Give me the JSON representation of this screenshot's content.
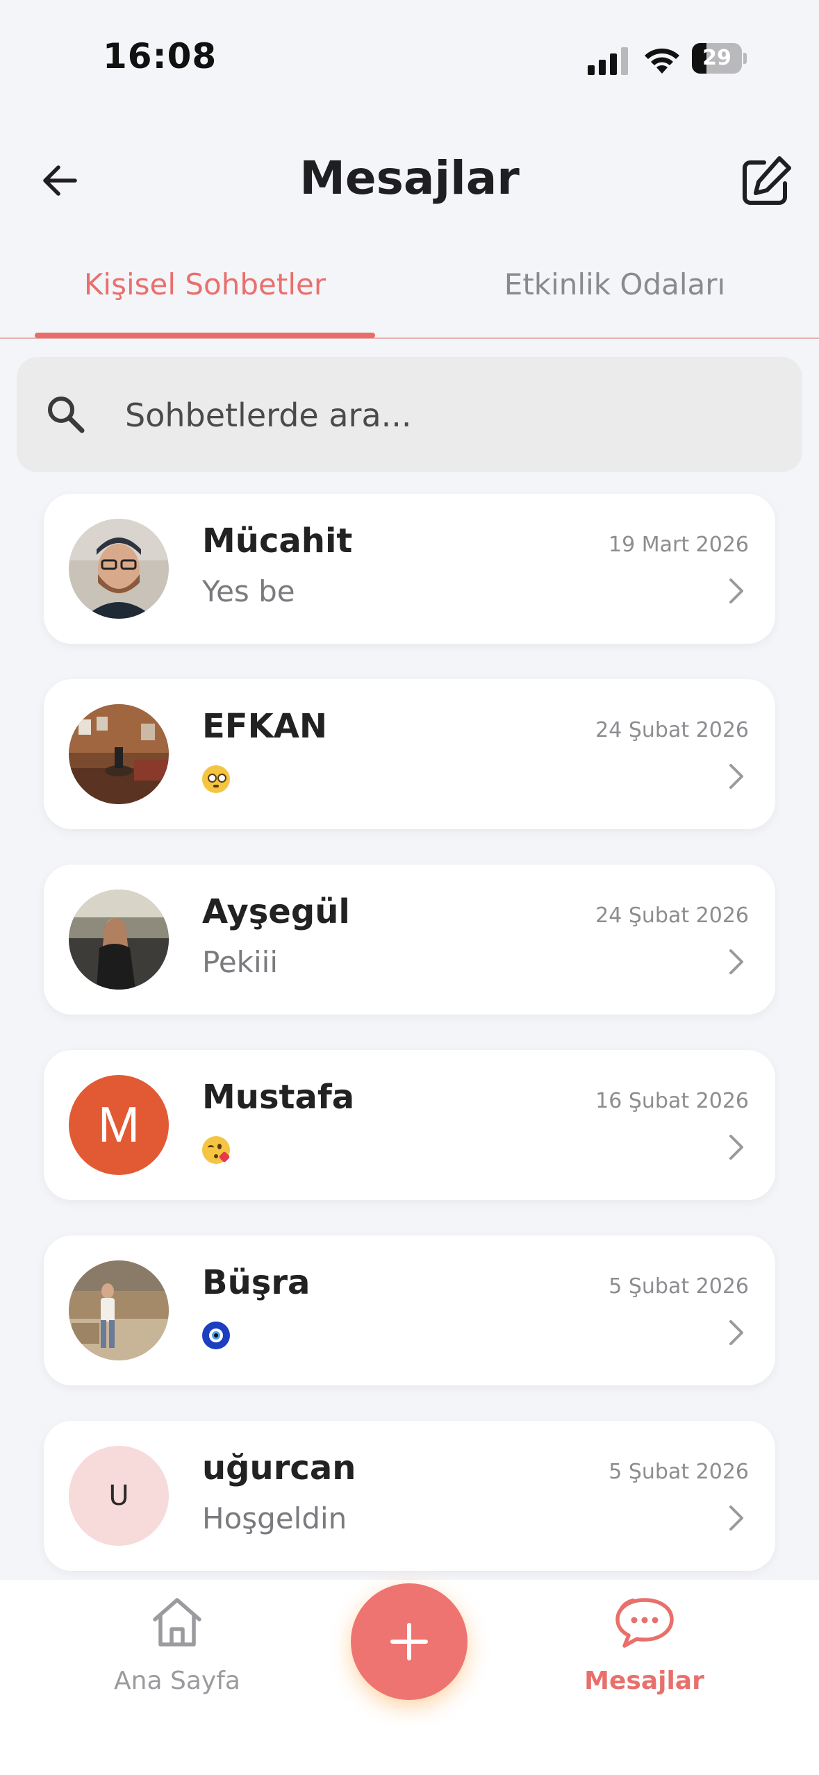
{
  "status_bar": {
    "time": "16:08",
    "battery": "29",
    "battery_level": 0.29
  },
  "header": {
    "title": "Mesajlar",
    "back_icon": "arrow-left-icon",
    "compose_icon": "compose-icon"
  },
  "tabs": [
    {
      "label": "Kişisel Sohbetler",
      "active": true
    },
    {
      "label": "Etkinlik Odaları",
      "active": false
    }
  ],
  "search": {
    "placeholder": "Sohbetlerde ara...",
    "value": ""
  },
  "chats": [
    {
      "name": "Mücahit",
      "preview": "Yes be",
      "date": "19 Mart 2026",
      "avatar": "photo"
    },
    {
      "name": "EFKAN",
      "preview": "😳",
      "date": "24 Şubat 2026",
      "avatar": "photo"
    },
    {
      "name": "Ayşegül",
      "preview": "Pekiii",
      "date": "24 Şubat 2026",
      "avatar": "photo"
    },
    {
      "name": "Mustafa",
      "preview": "😘",
      "date": "16 Şubat 2026",
      "avatar_letter": "M",
      "avatar_color": "#e25a33"
    },
    {
      "name": "Büşra",
      "preview": "🧿",
      "date": "5 Şubat 2026",
      "avatar": "photo"
    },
    {
      "name": "uğurcan",
      "preview": "Hoşgeldin",
      "date": "5 Şubat 2026",
      "avatar_letter": "U",
      "avatar_color": "#f7dada"
    }
  ],
  "bottom_nav": {
    "home": {
      "label": "Ana Sayfa",
      "icon": "home-icon"
    },
    "add": {
      "icon": "plus-icon"
    },
    "messages": {
      "label": "Mesajlar",
      "icon": "chat-bubble-icon"
    }
  },
  "colors": {
    "accent": "#ea6d68",
    "background": "#f4f5f9",
    "card": "#ffffff"
  }
}
